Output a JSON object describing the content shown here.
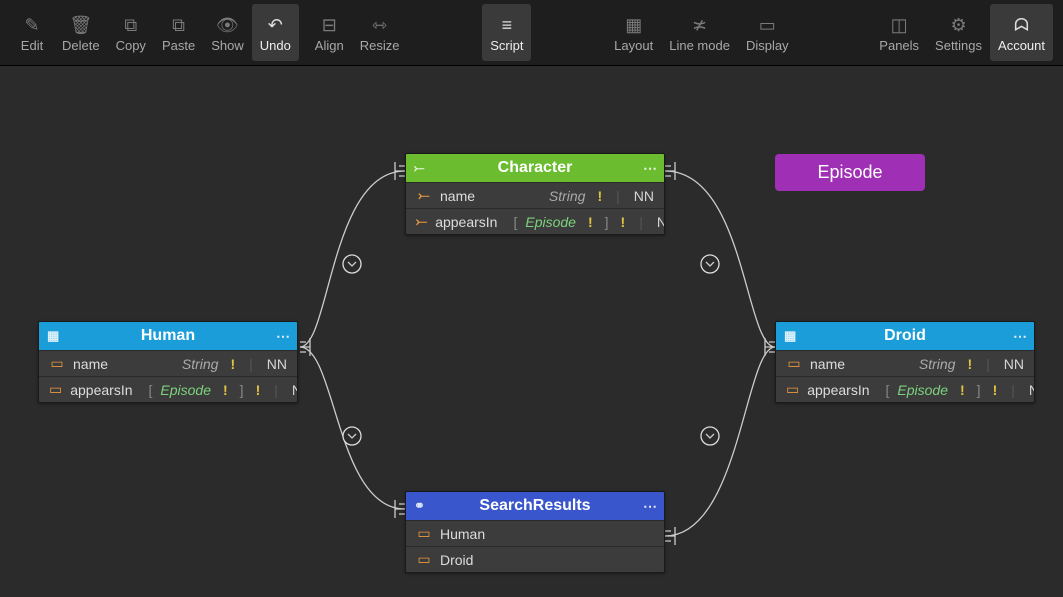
{
  "toolbar": {
    "edit": "Edit",
    "delete": "Delete",
    "copy": "Copy",
    "paste": "Paste",
    "show": "Show",
    "undo": "Undo",
    "align": "Align",
    "resize": "Resize",
    "script": "Script",
    "layout": "Layout",
    "linemode": "Line mode",
    "display": "Display",
    "panels": "Panels",
    "settings": "Settings",
    "account": "Account"
  },
  "enum_button": "Episode",
  "cards": {
    "character": {
      "title": "Character",
      "rows": [
        {
          "name": "name",
          "type": "String",
          "nn": "NN"
        },
        {
          "name": "appearsIn",
          "type": "Episode",
          "list": true,
          "nn": "NN"
        }
      ]
    },
    "human": {
      "title": "Human",
      "rows": [
        {
          "name": "name",
          "type": "String",
          "nn": "NN"
        },
        {
          "name": "appearsIn",
          "type": "Episode",
          "list": true,
          "nn": "NN"
        }
      ]
    },
    "droid": {
      "title": "Droid",
      "rows": [
        {
          "name": "name",
          "type": "String",
          "nn": "NN"
        },
        {
          "name": "appearsIn",
          "type": "Episode",
          "list": true,
          "nn": "NN"
        }
      ]
    },
    "search": {
      "title": "SearchResults",
      "rows": [
        {
          "name": "Human"
        },
        {
          "name": "Droid"
        }
      ]
    }
  }
}
